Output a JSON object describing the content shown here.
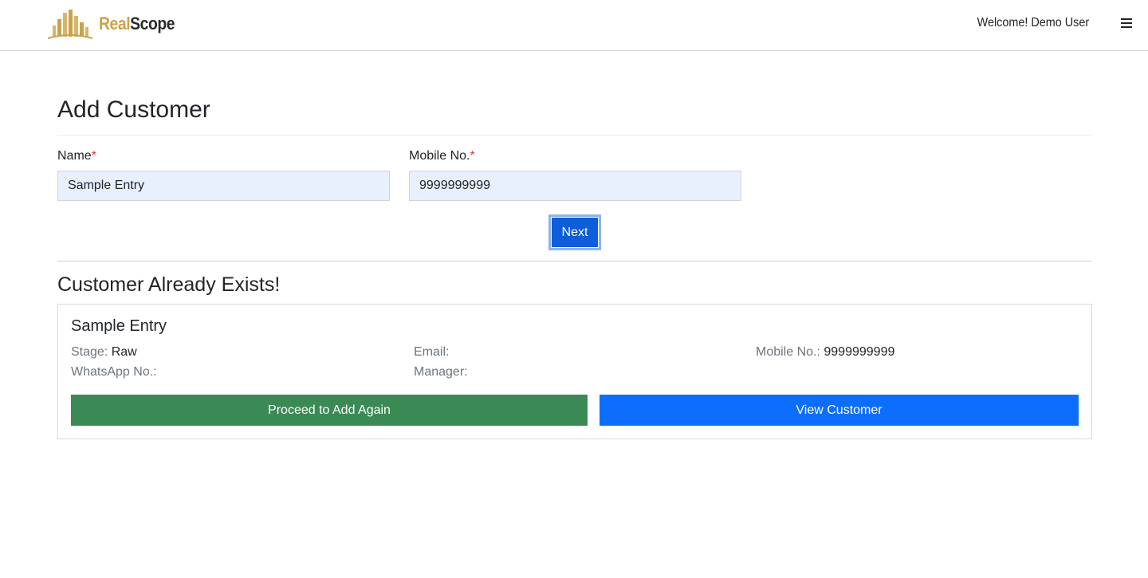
{
  "header": {
    "brand_part1": "Real",
    "brand_part2": "Scope",
    "welcome_text": "Welcome! Demo User",
    "menu_icon": "hamburger-menu-icon",
    "brand_colors": {
      "gold": "#c9a24a",
      "dark": "#2b2b2b"
    }
  },
  "form": {
    "title": "Add Customer",
    "name_label": "Name",
    "mobile_label": "Mobile No.",
    "required_marker": "*",
    "name_value": "Sample Entry",
    "mobile_value": "9999999999",
    "next_label": "Next"
  },
  "result": {
    "title": "Customer Already Exists!",
    "customer_name": "Sample Entry",
    "stage_label": "Stage:",
    "stage_value": "Raw",
    "whatsapp_label": "WhatsApp No.:",
    "whatsapp_value": "",
    "email_label": "Email:",
    "email_value": "",
    "manager_label": "Manager:",
    "manager_value": "",
    "mobile_label": "Mobile No.:",
    "mobile_value": "9999999999",
    "proceed_label": "Proceed to Add Again",
    "view_label": "View Customer"
  },
  "colors": {
    "primary": "#0d6efd",
    "success": "#3b8a55",
    "required": "#dc3545",
    "input_fill": "#e8f0fe"
  }
}
